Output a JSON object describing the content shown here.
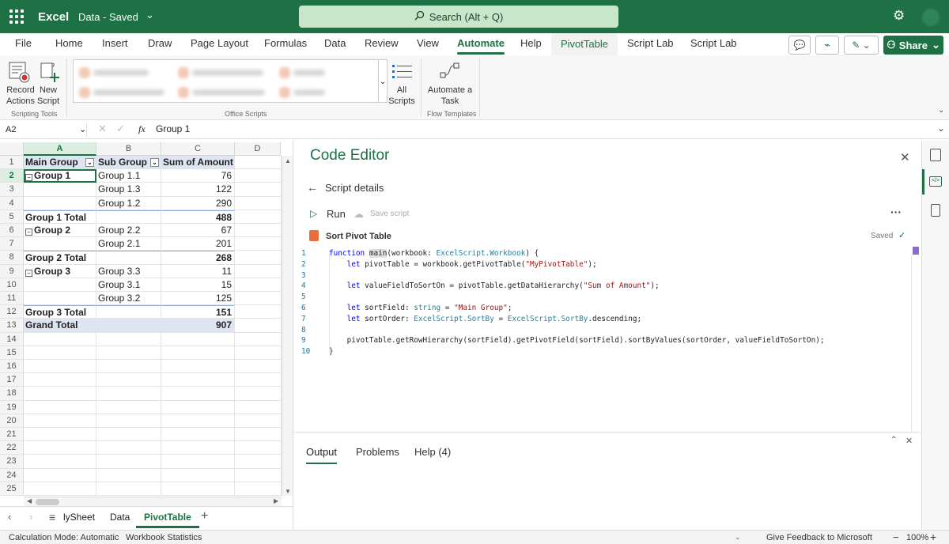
{
  "titlebar": {
    "app": "Excel",
    "doc": "Data - Saved",
    "search_placeholder": "Search (Alt + Q)"
  },
  "tabs": [
    "File",
    "Home",
    "Insert",
    "Draw",
    "Page Layout",
    "Formulas",
    "Data",
    "Review",
    "View",
    "Automate",
    "Help",
    "PivotTable",
    "Script Lab",
    "Script Lab"
  ],
  "share_label": "Share",
  "ribbon": {
    "record": [
      "Record",
      "Actions"
    ],
    "new_script": [
      "New",
      "Script"
    ],
    "scripting_tools": "Scripting Tools",
    "office_scripts": "Office Scripts",
    "all_scripts": [
      "All",
      "Scripts"
    ],
    "automate_task": [
      "Automate a",
      "Task"
    ],
    "flow_templates": "Flow Templates"
  },
  "formula": {
    "namebox": "A2",
    "fx": "fx",
    "value": "Group 1"
  },
  "sheet": {
    "columns": [
      "A",
      "B",
      "C",
      "D"
    ],
    "rows": [
      "1",
      "2",
      "3",
      "4",
      "5",
      "6",
      "7",
      "8",
      "9",
      "10",
      "11",
      "12",
      "13",
      "14",
      "15",
      "16",
      "17",
      "18",
      "19",
      "20",
      "21",
      "22",
      "23",
      "24",
      "25"
    ],
    "headers": [
      "Main Group",
      "Sub Group",
      "Sum of Amount"
    ],
    "data": [
      [
        "Group 1",
        "Group 1.1",
        "76"
      ],
      [
        "",
        "Group 1.3",
        "122"
      ],
      [
        "",
        "Group 1.2",
        "290"
      ],
      [
        "Group 1 Total",
        "",
        "488"
      ],
      [
        "Group 2",
        "Group 2.2",
        "67"
      ],
      [
        "",
        "Group 2.1",
        "201"
      ],
      [
        "Group 2 Total",
        "",
        "268"
      ],
      [
        "Group 3",
        "Group 3.3",
        "11"
      ],
      [
        "",
        "Group 3.1",
        "15"
      ],
      [
        "",
        "Group 3.2",
        "125"
      ],
      [
        "Group 3 Total",
        "",
        "151"
      ],
      [
        "Grand Total",
        "",
        "907"
      ]
    ]
  },
  "sheettabs": [
    "lySheet",
    "Data",
    "PivotTable"
  ],
  "editor": {
    "title": "Code Editor",
    "back": "Script details",
    "run": "Run",
    "save": "Save script",
    "script_name": "Sort Pivot Table",
    "saved": "Saved",
    "line_numbers": [
      "1",
      "2",
      "3",
      "4",
      "5",
      "6",
      "7",
      "8",
      "9",
      "10"
    ],
    "bottom_tabs": [
      "Output",
      "Problems",
      "Help (4)"
    ]
  },
  "status": {
    "calc": "Calculation Mode: Automatic",
    "stats": "Workbook Statistics",
    "feedback": "Give Feedback to Microsoft",
    "zoom": "100%"
  },
  "colors": {
    "brand": "#1e7145",
    "pivot_header": "#dde4f2"
  }
}
